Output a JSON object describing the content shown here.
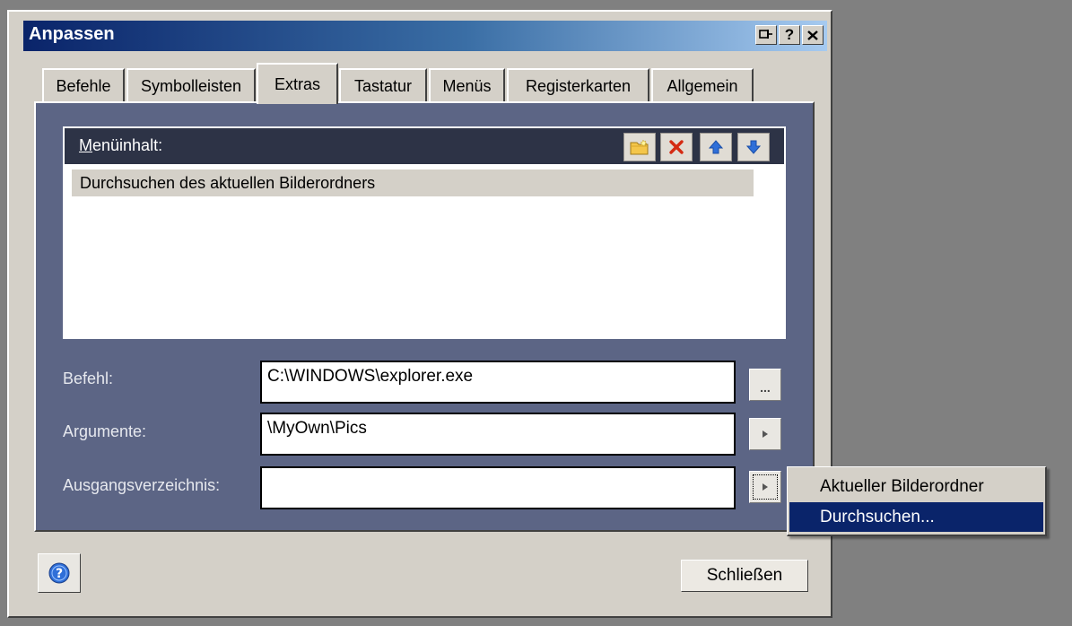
{
  "window": {
    "title": "Anpassen",
    "caption_buttons": {
      "pin": "⊠",
      "help": "?",
      "close": "×"
    }
  },
  "tabs": [
    {
      "label": "Befehle",
      "active": false
    },
    {
      "label": "Symbolleisten",
      "active": false
    },
    {
      "label": "Extras",
      "active": true
    },
    {
      "label": "Tastatur",
      "active": false
    },
    {
      "label": "Menüs",
      "active": false
    },
    {
      "label": "Registerkarten",
      "active": false
    },
    {
      "label": "Allgemein",
      "active": false
    }
  ],
  "menu_content": {
    "label_accel": "M",
    "label_rest": "enüinhalt:",
    "toolbar": [
      "new-folder-icon",
      "delete-icon",
      "move-up-icon",
      "move-down-icon"
    ],
    "items": [
      "Durchsuchen des aktuellen Bilderordners"
    ]
  },
  "fields": {
    "command": {
      "label": "Befehl:",
      "value": "C:\\WINDOWS\\explorer.exe",
      "button": "..."
    },
    "arguments": {
      "label": "Argumente:",
      "value": "\\MyOwn\\Pics"
    },
    "initial_dir": {
      "label": "Ausgangsverzeichnis:",
      "value": ""
    }
  },
  "buttons": {
    "close": "Schließen"
  },
  "popup_menu": {
    "items": [
      {
        "label": "Aktueller Bilderordner",
        "highlighted": false
      },
      {
        "label": "Durchsuchen...",
        "highlighted": true
      }
    ]
  },
  "colors": {
    "titlebar_start": "#0a246a",
    "titlebar_end": "#a6caf0",
    "tab_page": "#5c6585",
    "highlight": "#0a246a",
    "delete_red": "#d42a12",
    "arrow_blue": "#2f6fd8"
  }
}
